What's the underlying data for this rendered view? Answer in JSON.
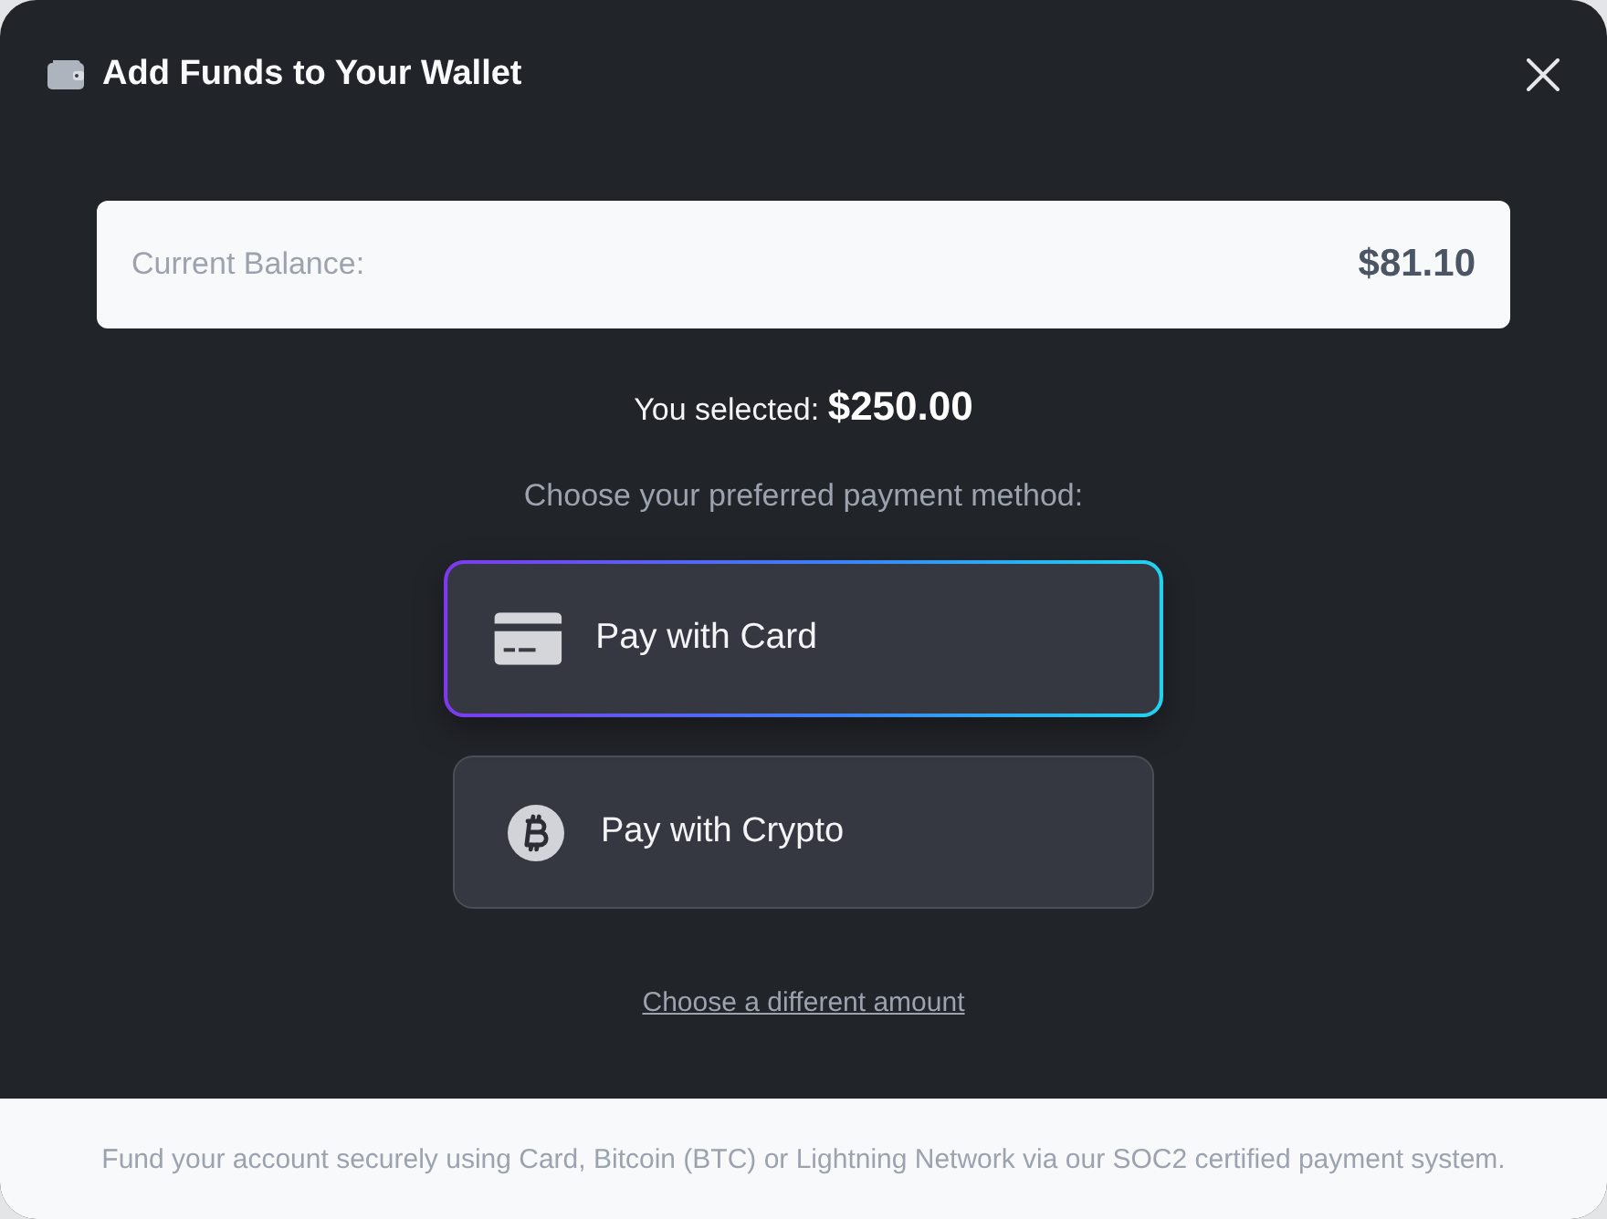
{
  "window": {
    "title": "Add Funds to Your Wallet"
  },
  "balance": {
    "label": "Current Balance:",
    "amount": "$81.10"
  },
  "selection": {
    "text": "You selected: **$250.00**"
  },
  "prompt": "Choose your preferred payment method:",
  "payment_methods": [
    {
      "label": "Pay with Card",
      "kind": "card",
      "selected": true
    },
    {
      "label": "Pay with Crypto",
      "kind": "crypto",
      "selected": false
    }
  ],
  "change_amount_link": "Choose a different amount",
  "footer": "Fund your account securely using Card, Bitcoin (BTC) or Lightning Network via our SOC2 certified payment system."
}
